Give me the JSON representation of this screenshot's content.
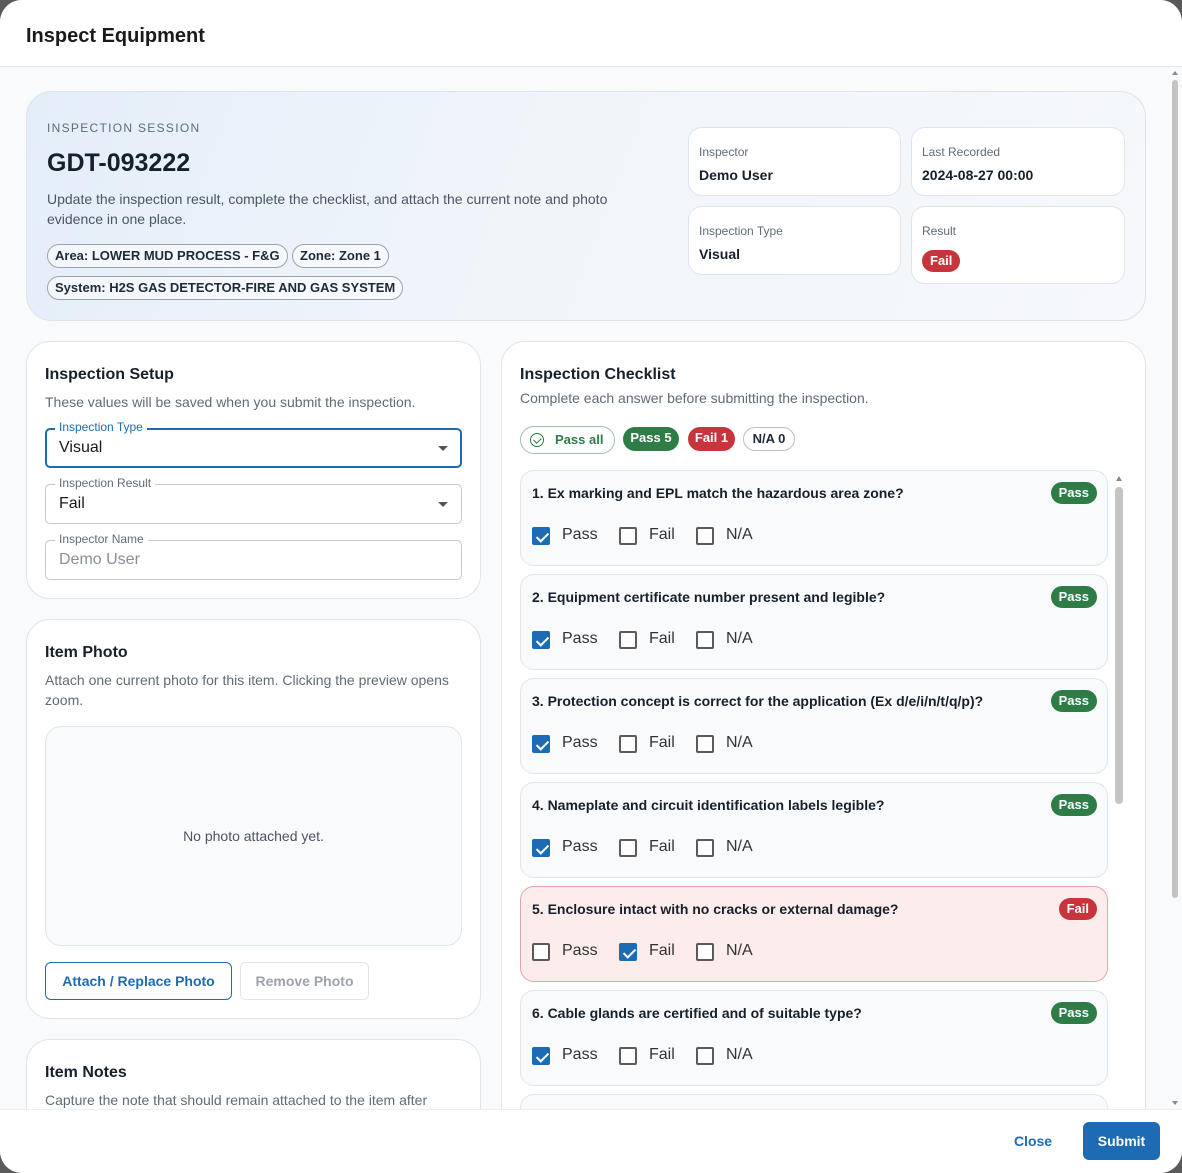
{
  "dialog": {
    "title": "Inspect Equipment"
  },
  "session": {
    "eyebrow": "INSPECTION SESSION",
    "id": "GDT-093222",
    "description": "Update the inspection result, complete the checklist, and attach the current note and photo evidence in one place.",
    "chips": [
      "Area: LOWER MUD PROCESS - F&G",
      "Zone: Zone 1",
      "System: H2S GAS DETECTOR-FIRE AND GAS SYSTEM"
    ],
    "inspector_label": "Inspector",
    "inspector_value": "Demo User",
    "last_recorded_label": "Last Recorded",
    "last_recorded_value": "2024-08-27 00:00",
    "inspection_type_label": "Inspection Type",
    "inspection_type_value": "Visual",
    "result_label": "Result",
    "result_value": "Fail"
  },
  "setup": {
    "title": "Inspection Setup",
    "subtitle": "These values will be saved when you submit the inspection.",
    "type_label": "Inspection Type",
    "type_value": "Visual",
    "result_label": "Inspection Result",
    "result_value": "Fail",
    "name_label": "Inspector Name",
    "name_placeholder": "Demo User"
  },
  "photo": {
    "title": "Item Photo",
    "subtitle": "Attach one current photo for this item. Clicking the preview opens zoom.",
    "empty_text": "No photo attached yet.",
    "attach_label": "Attach / Replace Photo",
    "remove_label": "Remove Photo"
  },
  "notes": {
    "title": "Item Notes",
    "subtitle": "Capture the note that should remain attached to the item after"
  },
  "checklist": {
    "title": "Inspection Checklist",
    "subtitle": "Complete each answer before submitting the inspection.",
    "pass_all_label": "Pass all",
    "pass_count_label": "Pass 5",
    "fail_count_label": "Fail 1",
    "na_count_label": "N/A 0",
    "option_labels": [
      "Pass",
      "Fail",
      "N/A"
    ],
    "items": [
      {
        "question": "1. Ex marking and EPL match the hazardous area zone?",
        "answer": "Pass"
      },
      {
        "question": "2. Equipment certificate number present and legible?",
        "answer": "Pass"
      },
      {
        "question": "3. Protection concept is correct for the application (Ex d/e/i/n/t/q/p)?",
        "answer": "Pass"
      },
      {
        "question": "4. Nameplate and circuit identification labels legible?",
        "answer": "Pass"
      },
      {
        "question": "5. Enclosure intact with no cracks or external damage?",
        "answer": "Fail"
      },
      {
        "question": "6. Cable glands are certified and of suitable type?",
        "answer": "Pass"
      }
    ]
  },
  "footer": {
    "close_label": "Close",
    "submit_label": "Submit"
  },
  "colors": {
    "accent": "#1d6bb3",
    "pass": "#2e7d46",
    "fail": "#c7353c",
    "fail_bg": "#fdecec"
  }
}
